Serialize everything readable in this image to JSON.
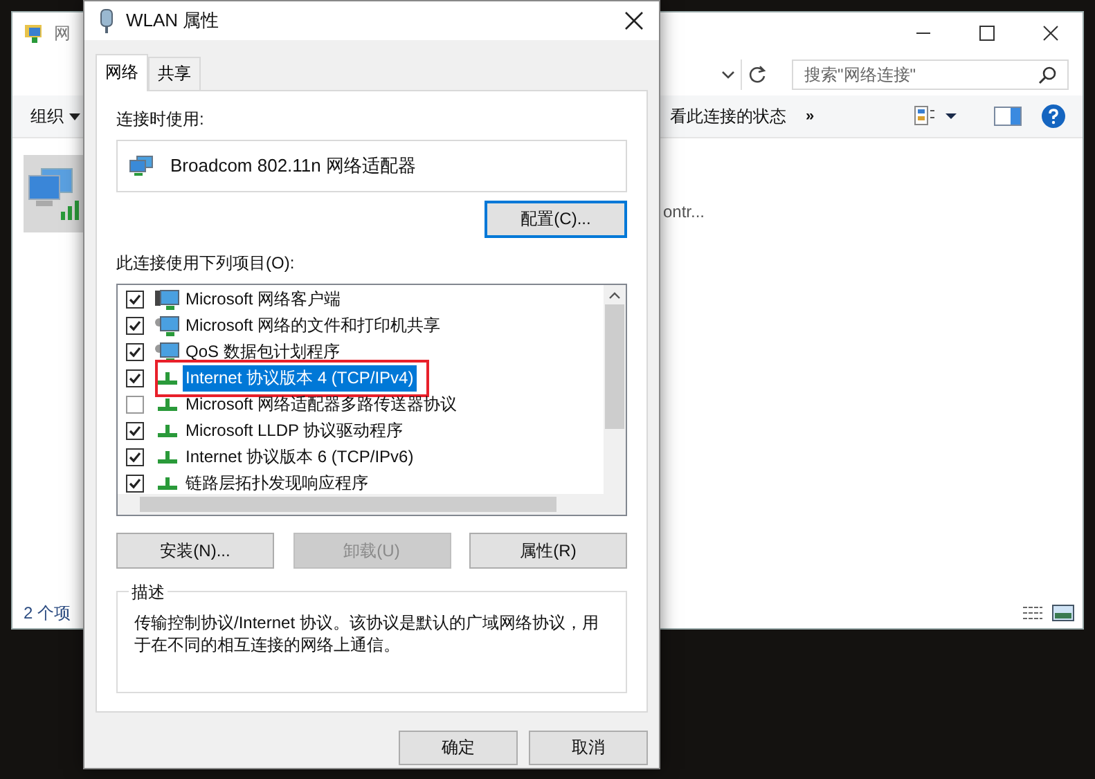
{
  "background_window": {
    "title": "网",
    "search": {
      "placeholder": "搜索\"网络连接\""
    },
    "toolbar": {
      "organize": "组织",
      "view_status": "看此连接的状态",
      "more": "»"
    },
    "content": {
      "item_selected": true,
      "item_text": "ontr..."
    },
    "status_bar": "2 个项"
  },
  "dialog": {
    "title": "WLAN 属性",
    "tabs": [
      {
        "label": "网络",
        "selected": true
      },
      {
        "label": "共享",
        "selected": false
      }
    ],
    "connect_using_label": "连接时使用:",
    "adapter": "Broadcom 802.11n 网络适配器",
    "configure_button": {
      "label": "配置(C)...",
      "focused": true
    },
    "items_label": "此连接使用下列项目(O):",
    "items": [
      {
        "label": "Microsoft 网络客户端",
        "kind": "client",
        "checked": true,
        "selected": false,
        "marked": false
      },
      {
        "label": "Microsoft 网络的文件和打印机共享",
        "kind": "service",
        "checked": true,
        "selected": false,
        "marked": false
      },
      {
        "label": "QoS 数据包计划程序",
        "kind": "service",
        "checked": true,
        "selected": false,
        "marked": false
      },
      {
        "label": "Internet 协议版本 4 (TCP/IPv4)",
        "kind": "protocol",
        "checked": true,
        "selected": true,
        "marked": true
      },
      {
        "label": "Microsoft 网络适配器多路传送器协议",
        "kind": "protocol",
        "checked": false,
        "selected": false,
        "marked": false
      },
      {
        "label": "Microsoft LLDP 协议驱动程序",
        "kind": "protocol",
        "checked": true,
        "selected": false,
        "marked": false
      },
      {
        "label": "Internet 协议版本 6 (TCP/IPv6)",
        "kind": "protocol",
        "checked": true,
        "selected": false,
        "marked": false
      },
      {
        "label": "链路层拓扑发现响应程序",
        "kind": "protocol",
        "checked": true,
        "selected": false,
        "marked": false
      }
    ],
    "buttons": [
      {
        "label": "安装(N)...",
        "disabled": false
      },
      {
        "label": "卸载(U)",
        "disabled": true
      },
      {
        "label": "属性(R)",
        "disabled": false
      }
    ],
    "description": {
      "title": "描述",
      "text": "传输控制协议/Internet 协议。该协议是默认的广域网络协议，用于在不同的相互连接的网络上通信。"
    },
    "footer_buttons": [
      "确定",
      "取消"
    ]
  }
}
